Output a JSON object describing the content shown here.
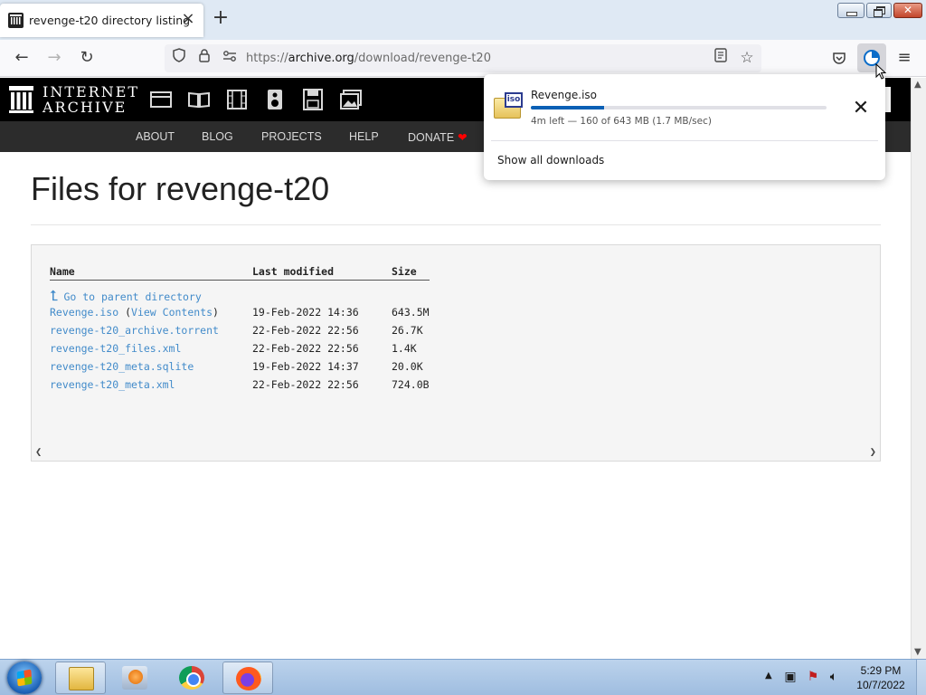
{
  "browser": {
    "tab_title": "revenge-t20 directory listing",
    "tab_close_icon": "close-icon",
    "new_tab_icon": "plus-icon",
    "url_scheme": "https://",
    "url_host": "archive.org",
    "url_path": "/download/revenge-t20",
    "icons": [
      "back-icon",
      "forward-icon",
      "reload-icon",
      "shield-icon",
      "lock-icon",
      "permissions-icon",
      "reader-view-icon",
      "bookmark-star-icon",
      "pocket-icon",
      "downloads-icon",
      "hamburger-menu-icon"
    ]
  },
  "ia_header": {
    "logo_line1": "INTERNET",
    "logo_line2": "ARCHIVE",
    "media_icons": [
      "web-icon",
      "texts-icon",
      "video-icon",
      "audio-icon",
      "software-icon",
      "images-icon"
    ],
    "nav": [
      "ABOUT",
      "BLOG",
      "PROJECTS",
      "HELP",
      "DONATE"
    ],
    "donate_heart": "❤"
  },
  "page": {
    "title": "Files for revenge-t20",
    "listing": {
      "headers": {
        "name": "Name",
        "modified": "Last modified",
        "size": "Size"
      },
      "parent_label": "Go to parent directory",
      "rows": [
        {
          "name": "Revenge.iso",
          "extra_open": " (",
          "extra_link": "View Contents",
          "extra_close": ")",
          "modified": "19-Feb-2022 14:36",
          "size": "643.5M"
        },
        {
          "name": "revenge-t20_archive.torrent",
          "modified": "22-Feb-2022 22:56",
          "size": "26.7K"
        },
        {
          "name": "revenge-t20_files.xml",
          "modified": "22-Feb-2022 22:56",
          "size": "1.4K"
        },
        {
          "name": "revenge-t20_meta.sqlite",
          "modified": "19-Feb-2022 14:37",
          "size": "20.0K"
        },
        {
          "name": "revenge-t20_meta.xml",
          "modified": "22-Feb-2022 22:56",
          "size": "724.0B"
        }
      ]
    }
  },
  "downloads_panel": {
    "file_name": "Revenge.iso",
    "file_icon_label": "iso",
    "progress_fraction": 0.249,
    "status": "4m left — 160 of 643 MB (1.7 MB/sec)",
    "show_all": "Show all downloads",
    "cancel_icon": "close-icon"
  },
  "taskbar": {
    "apps": [
      "windows-explorer",
      "media-player",
      "google-chrome",
      "firefox"
    ],
    "active_app": "firefox",
    "time": "5:29 PM",
    "date": "10/7/2022"
  },
  "colors": {
    "link": "#428bca",
    "ia_top_bar": "#000000",
    "ia_nav_bar": "#2c2c2c",
    "download_progress": "#0a60b5",
    "donate_heart": "#ff0100"
  }
}
